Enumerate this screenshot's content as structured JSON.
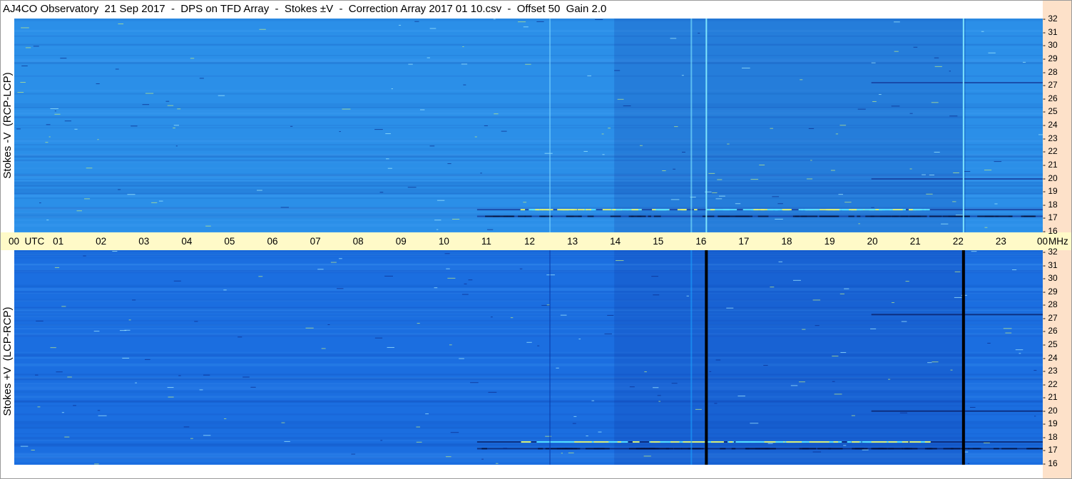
{
  "title": "AJ4CO Observatory  21 Sep 2017  -  DPS on TFD Array  -  Stokes ±V  -  Correction Array 2017 01 10.csv  -  Offset 50  Gain 2.0",
  "panels": [
    {
      "id": "top",
      "ylabel": "Stokes -V  (RCP-LCP)",
      "base_color": "#2b8fe8",
      "strong_band_color": "#1a4fb0"
    },
    {
      "id": "bottom",
      "ylabel": "Stokes +V  (LCP-RCP)",
      "base_color": "#1b6ee0",
      "strong_band_color": "#071a4a"
    }
  ],
  "chart_data": {
    "type": "heatmap",
    "time_axis": {
      "labels": [
        "00  UTC",
        "01",
        "02",
        "03",
        "04",
        "05",
        "06",
        "07",
        "08",
        "09",
        "10",
        "11",
        "12",
        "13",
        "14",
        "15",
        "16",
        "17",
        "18",
        "19",
        "20",
        "21",
        "22",
        "23",
        "00"
      ],
      "range_hours": [
        0,
        24
      ],
      "unit": "UTC"
    },
    "freq_axis": {
      "ticks": [
        "32",
        "31",
        "30",
        "29",
        "28",
        "27",
        "26",
        "25",
        "24",
        "23",
        "22",
        "21",
        "20",
        "19",
        "18",
        "17",
        "16"
      ],
      "range_mhz": [
        16,
        32
      ],
      "unit": "MHz"
    },
    "features": {
      "vertical_lines_utc": [
        12.5,
        15.8,
        16.15,
        22.15
      ],
      "horizontal_bands_mhz": [
        17.2,
        17.7,
        20.0,
        27.2
      ],
      "band_activity_hours": [
        10.8,
        24
      ]
    }
  }
}
